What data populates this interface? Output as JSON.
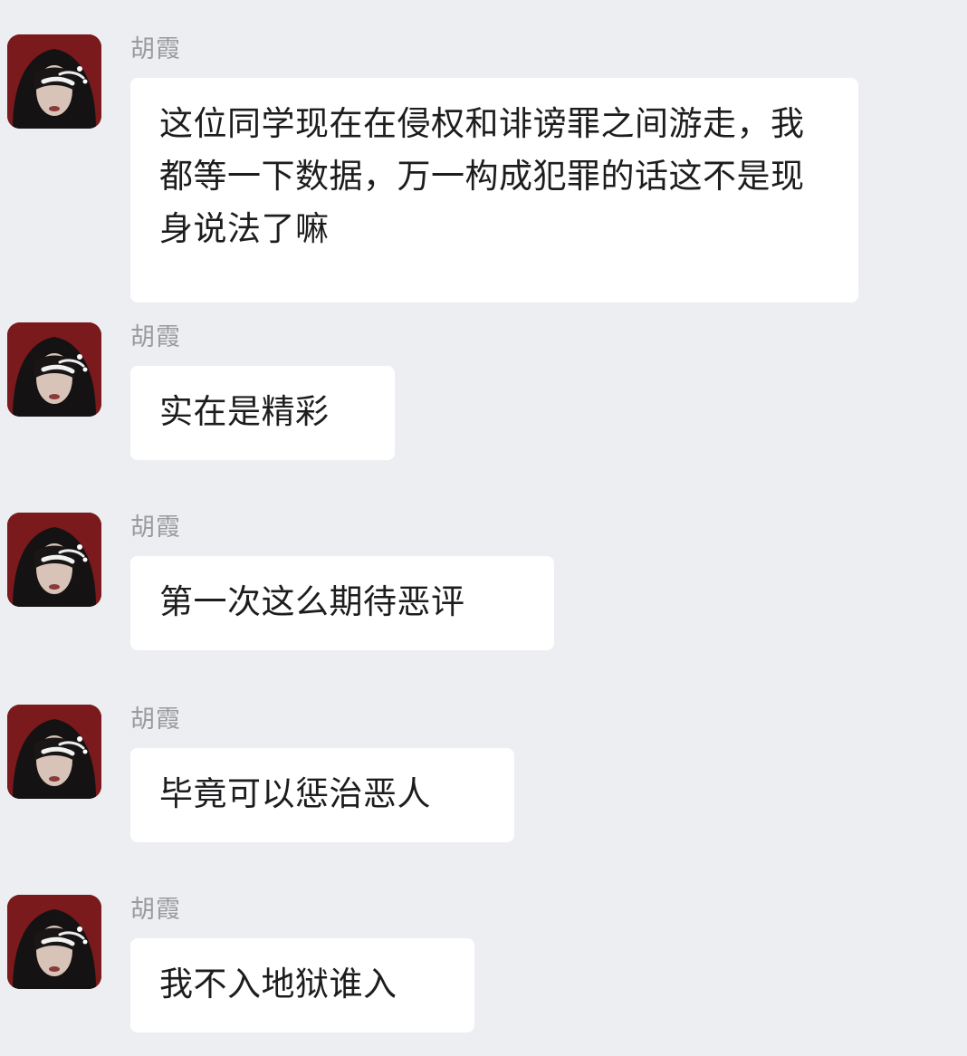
{
  "messages": [
    {
      "sender": "胡霞",
      "text": "这位同学现在在侵权和诽谤罪之间游走，我都等一下数据，万一构成犯罪的话这不是现身说法了嘛"
    },
    {
      "sender": "胡霞",
      "text": "实在是精彩"
    },
    {
      "sender": "胡霞",
      "text": "第一次这么期待恶评"
    },
    {
      "sender": "胡霞",
      "text": "毕竟可以惩治恶人"
    },
    {
      "sender": "胡霞",
      "text": "我不入地狱谁入"
    }
  ],
  "colors": {
    "background": "#eceef1",
    "bubble": "#ffffff",
    "sender": "#9a9b9e",
    "text": "#1d1d1f",
    "avatar_bg": "#7a1a1c"
  },
  "icons": {
    "avatar": "user-avatar-icon"
  }
}
